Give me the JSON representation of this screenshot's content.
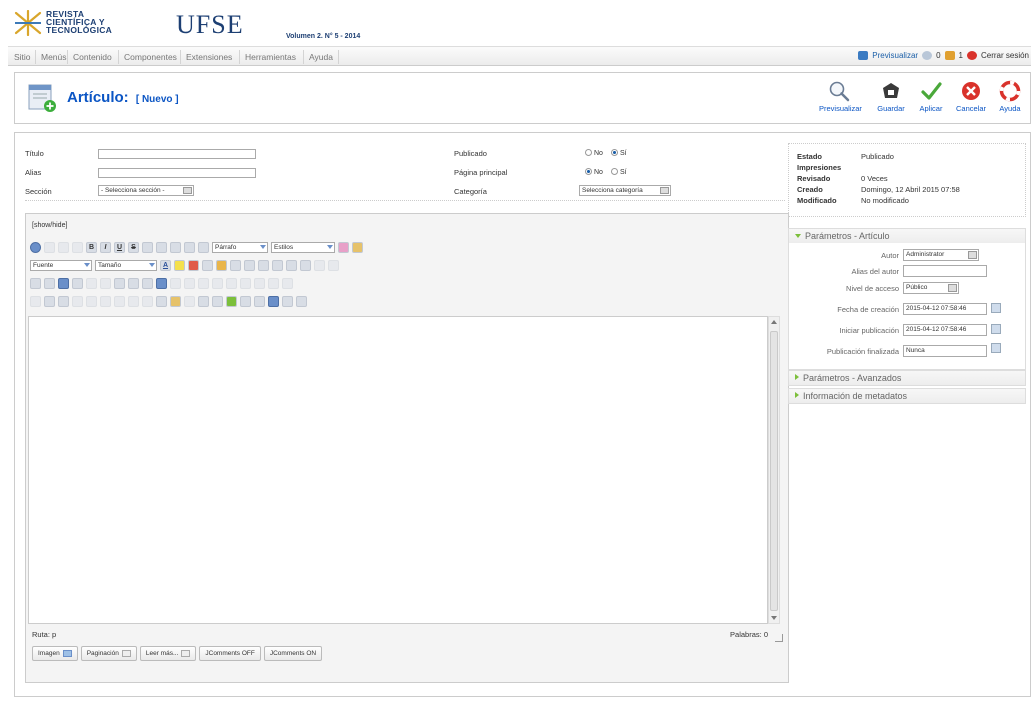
{
  "header": {
    "logo_line1": "REVISTA",
    "logo_line2": "CIENTÍFICA Y",
    "logo_line3": "TECNOLÓGICA",
    "brand": "UFSE",
    "volume": "Volumen 2. N° 5 - 2014"
  },
  "menubar": {
    "items": [
      "Sitio",
      "Menús",
      "Contenido",
      "Componentes",
      "Extensiones",
      "Herramientas",
      "Ayuda"
    ],
    "preview_label": "Previsualizar",
    "messages_count": "0",
    "users_count": "1",
    "logout_label": "Cerrar sesión"
  },
  "toolbar": {
    "title": "Artículo:",
    "subtitle": "[ Nuevo ]",
    "buttons": {
      "preview": "Previsualizar",
      "save": "Guardar",
      "apply": "Aplicar",
      "cancel": "Cancelar",
      "help": "Ayuda"
    }
  },
  "form": {
    "title_label": "Título",
    "alias_label": "Alias",
    "section_label": "Sección",
    "section_value": "- Selecciona sección -",
    "published_label": "Publicado",
    "frontpage_label": "Página principal",
    "category_label": "Categoría",
    "category_value": "Selecciona categoría",
    "no_label": "No",
    "yes_label": "Sí",
    "published_yes": true,
    "frontpage_no": true
  },
  "editor": {
    "showhide": "[show/hide]",
    "format_select": "Párrafo",
    "styles_select": "Estilos",
    "font_select": "Fuente",
    "size_select": "Tamaño",
    "path": "Ruta: p",
    "words": "Palabras: 0",
    "buttons": [
      "Imagen",
      "Paginación",
      "Leer más...",
      "JComments OFF",
      "JComments ON"
    ]
  },
  "info": {
    "estado_label": "Estado",
    "estado_value": "Publicado",
    "impresiones_label": "Impresiones",
    "revisado_label": "Revisado",
    "revisado_value": "0 Veces",
    "creado_label": "Creado",
    "creado_value": "Domingo, 12 Abril 2015 07:58",
    "modificado_label": "Modificado",
    "modificado_value": "No modificado"
  },
  "params": {
    "articulo_title": "Parámetros - Artículo",
    "autor_label": "Autor",
    "autor_value": "Administrator",
    "alias_autor_label": "Alias del autor",
    "nivel_label": "Nivel de acceso",
    "nivel_value": "Público",
    "fecha_creacion_label": "Fecha de creación",
    "fecha_creacion_value": "2015-04-12 07:58:46",
    "iniciar_label": "Iniciar publicación",
    "iniciar_value": "2015-04-12 07:58:46",
    "finalizada_label": "Publicación finalizada",
    "finalizada_value": "Nunca",
    "avanzados_title": "Parámetros - Avanzados",
    "metadatos_title": "Información de metadatos"
  },
  "colors": {
    "accent": "#0b55c4",
    "green": "#7cbf3b",
    "cancel_red": "#d9322b"
  }
}
